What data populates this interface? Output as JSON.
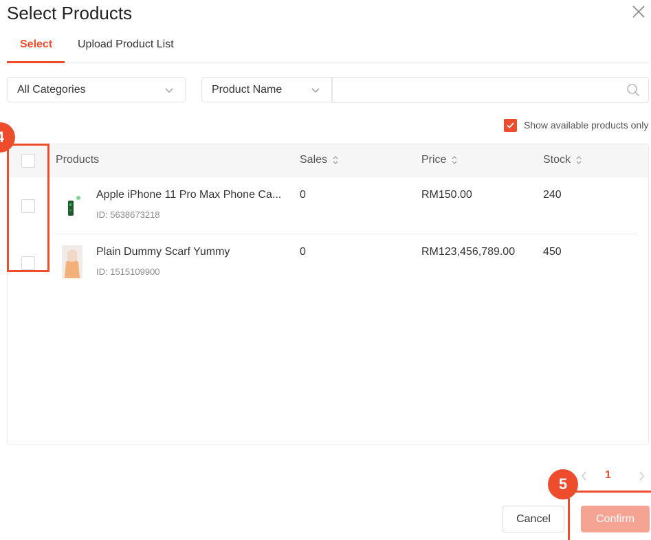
{
  "dialog": {
    "title": "Select Products"
  },
  "tabs": [
    {
      "label": "Select",
      "active": true
    },
    {
      "label": "Upload Product List",
      "active": false
    }
  ],
  "filters": {
    "category": "All Categories",
    "search_field": "Product Name",
    "search_value": ""
  },
  "available_only": {
    "label": "Show available products only",
    "checked": true
  },
  "table": {
    "columns": {
      "products": "Products",
      "sales": "Sales",
      "price": "Price",
      "stock": "Stock"
    },
    "rows": [
      {
        "name": "Apple iPhone 11 Pro Max Phone Ca...",
        "id": "ID: 5638673218",
        "sales": "0",
        "price": "RM150.00",
        "stock": "240",
        "checked": false
      },
      {
        "name": "Plain Dummy Scarf Yummy",
        "id": "ID: 1515109900",
        "sales": "0",
        "price": "RM123,456,789.00",
        "stock": "450",
        "checked": false
      }
    ]
  },
  "pagination": {
    "current_page": "1"
  },
  "buttons": {
    "cancel": "Cancel",
    "confirm": "Confirm"
  },
  "annotations": {
    "step4": "4",
    "step5": "5"
  },
  "colors": {
    "accent": "#ee4d2d",
    "confirm_disabled": "#f5a493"
  }
}
